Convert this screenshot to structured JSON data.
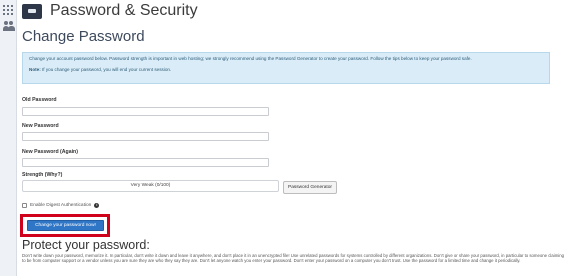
{
  "page": {
    "title": "Password & Security",
    "section_title": "Change Password"
  },
  "info": {
    "text": "Change your account password below. Password strength is important in web hosting; we strongly recommend using the Password Generator to create your password. Follow the tips below to keep your password safe.",
    "note_label": "Note:",
    "note_text": "If you change your password, you will end your current session."
  },
  "form": {
    "old_password_label": "Old Password",
    "new_password_label": "New Password",
    "new_password_again_label": "New Password (Again)",
    "strength_label": "Strength (Why?)",
    "strength_value": "Very Weak (0/100)",
    "generator_button": "Password Generator",
    "digest_label": "Enable Digest Authentication",
    "submit_button": "Change your password now!"
  },
  "protect": {
    "title": "Protect your password:",
    "text": "Don't write down your password, memorize it. In particular, don't write it down and leave it anywhere, and don't place it in an unencrypted file! Use unrelated passwords for systems controlled by different organizations. Don't give or share your password, in particular to someone claiming to be from computer support or a vendor unless you are sure they are who they say they are. Don't let anyone watch you enter your password. Don't enter your password on a computer you don't trust. Use the password for a limited time and change it periodically."
  },
  "colors": {
    "accent_button": "#2f76c7",
    "highlight_border": "#d0021b",
    "info_background": "#d9ecf7"
  },
  "icons": {
    "sidebar": [
      "apps-grid-icon",
      "users-icon"
    ],
    "header": "password-security-icon",
    "digest_help": "info-icon"
  }
}
